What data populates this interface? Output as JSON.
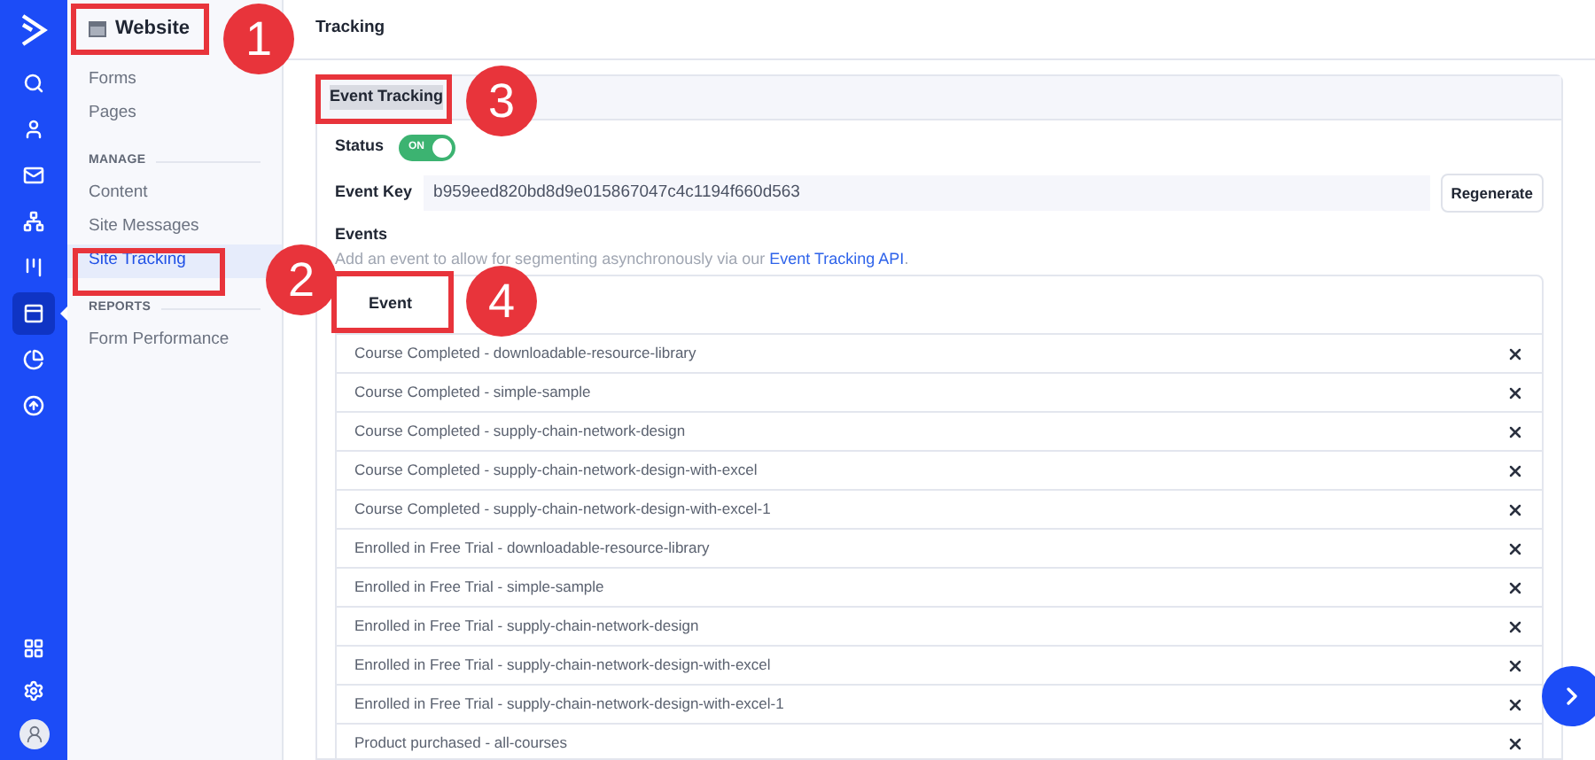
{
  "rail": [
    {
      "kind": "search",
      "selected": false
    },
    {
      "kind": "contacts",
      "selected": false
    },
    {
      "kind": "mail",
      "selected": false
    },
    {
      "kind": "automations",
      "selected": false
    },
    {
      "kind": "deals",
      "selected": false
    },
    {
      "kind": "website",
      "selected": true
    },
    {
      "kind": "reports",
      "selected": false
    },
    {
      "kind": "upgrade",
      "selected": false
    }
  ],
  "rail_bottom": [
    {
      "kind": "apps"
    },
    {
      "kind": "settings"
    },
    {
      "kind": "account"
    }
  ],
  "sidebar": {
    "title": "Website",
    "sections": [
      {
        "items": [
          {
            "label": "Forms",
            "selected": false
          },
          {
            "label": "Pages",
            "selected": false
          }
        ]
      },
      {
        "heading": "MANAGE",
        "items": [
          {
            "label": "Content",
            "selected": false
          },
          {
            "label": "Site Messages",
            "selected": false
          },
          {
            "label": "Site Tracking",
            "selected": true
          }
        ]
      },
      {
        "heading": "REPORTS",
        "items": [
          {
            "label": "Form Performance",
            "selected": false
          }
        ]
      }
    ]
  },
  "page": {
    "title": "Tracking"
  },
  "panel": {
    "title": "Event Tracking",
    "status": {
      "label": "Status",
      "on": true,
      "toggle_text": "ON"
    },
    "event_key": {
      "label": "Event Key",
      "value": "b959eed820bd8d9e015867047c4c1194f660d563",
      "button": "Regenerate"
    },
    "events": {
      "label": "Events",
      "description": "Add an event to allow for segmenting asynchronously via our ",
      "link": "Event Tracking API",
      "description_end": ".",
      "column": "Event",
      "rows": [
        "Course Completed - downloadable-resource-library",
        "Course Completed - simple-sample",
        "Course Completed - supply-chain-network-design",
        "Course Completed - supply-chain-network-design-with-excel",
        "Course Completed - supply-chain-network-design-with-excel-1",
        "Enrolled in Free Trial - downloadable-resource-library",
        "Enrolled in Free Trial - simple-sample",
        "Enrolled in Free Trial - supply-chain-network-design",
        "Enrolled in Free Trial - supply-chain-network-design-with-excel",
        "Enrolled in Free Trial - supply-chain-network-design-with-excel-1",
        "Product purchased - all-courses"
      ]
    }
  },
  "callouts": [
    {
      "number": "1"
    },
    {
      "number": "2"
    },
    {
      "number": "3"
    },
    {
      "number": "4"
    }
  ]
}
